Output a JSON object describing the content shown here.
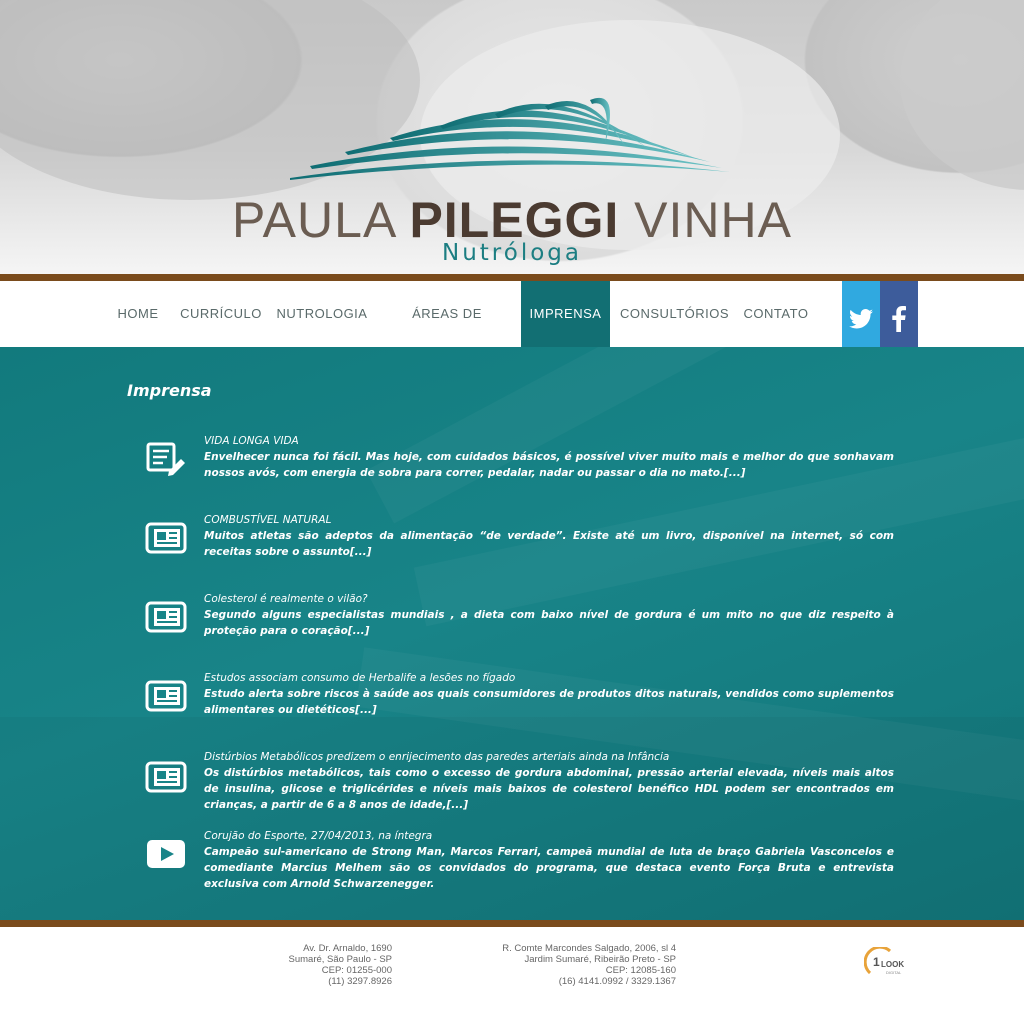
{
  "header": {
    "logo_name_1": "PAULA ",
    "logo_name_2": "PILEGGI",
    "logo_name_3": " VINHA",
    "logo_sub": "Nutróloga",
    "accent_color": "#1c7e82",
    "brown_bar_color": "#7a4b1c"
  },
  "nav": {
    "items": [
      {
        "label": "HOME"
      },
      {
        "label": "CURRÍCULO"
      },
      {
        "label": "NUTROLOGIA"
      },
      {
        "label": "ÁREAS DE ATUAÇÃO"
      },
      {
        "label": "IMPRENSA",
        "active": true
      },
      {
        "label": "CONSULTÓRIOS"
      },
      {
        "label": "CONTATO"
      }
    ],
    "social": [
      {
        "icon": "twitter-icon",
        "color": "#30a9e0"
      },
      {
        "icon": "facebook-icon",
        "color": "#3d5c9b"
      }
    ]
  },
  "main": {
    "title": "Imprensa",
    "articles": [
      {
        "icon": "document-edit-icon",
        "title": "VIDA LONGA VIDA",
        "body": "Envelhecer nunca foi fácil. Mas hoje, com cuidados básicos, é possível viver muito mais e melhor do que sonhavam nossos avós, com energia de sobra para correr, pedalar, nadar ou passar o dia no mato.[...]"
      },
      {
        "icon": "newspaper-icon",
        "title": "COMBUSTÍVEL NATURAL",
        "body": "Muitos atletas são adeptos da alimentação “de verdade”. Existe até um livro, disponível na internet, só com receitas sobre o assunto[...]"
      },
      {
        "icon": "newspaper-icon",
        "title": "Colesterol é realmente o vilão?",
        "body": "Segundo alguns especialistas mundiais , a dieta com baixo nível de gordura é um mito no que diz respeito à proteção para o coração[...]"
      },
      {
        "icon": "newspaper-icon",
        "title": "Estudos associam consumo de Herbalife a lesões no fígado",
        "body": "Estudo alerta sobre riscos à saúde aos quais consumidores de produtos ditos naturais, vendidos como suplementos alimentares ou dietéticos[...]"
      },
      {
        "icon": "newspaper-icon",
        "title": "Distúrbios Metabólicos predizem o enrijecimento das paredes arteriais ainda na Infância",
        "body": "Os distúrbios metabólicos, tais como o excesso de gordura abdominal, pressão arterial elevada, níveis mais altos de insulina, glicose e triglicérides e níveis mais baixos de colesterol benéfico HDL podem ser encontrados em crianças, a partir de 6 a 8 anos de idade,[...]"
      },
      {
        "icon": "video-play-icon",
        "title": "Corujão do Esporte, 27/04/2013, na íntegra",
        "body": "Campeão sul-americano de Strong Man, Marcos Ferrari, campeã mundial de luta de braço Gabriela Vasconcelos e comediante Marcius Melhem são os convidados do programa, que destaca evento Força Bruta e entrevista exclusiva com Arnold Schwarzenegger."
      }
    ]
  },
  "footer": {
    "address1": [
      "Av. Dr. Arnaldo, 1690",
      "Sumaré, São Paulo - SP",
      "CEP: 01255-000",
      "(11) 3297.8926"
    ],
    "address2": [
      "R. Comte Marcondes Salgado, 2006, sl 4",
      "Jardim Sumaré, Ribeirão Preto - SP",
      "CEP: 12085-160",
      "(16) 4141.0992 / 3329.1367"
    ],
    "brand_text": "LOOK",
    "brand_num": "1",
    "brand_sub": "DIGITAL"
  }
}
